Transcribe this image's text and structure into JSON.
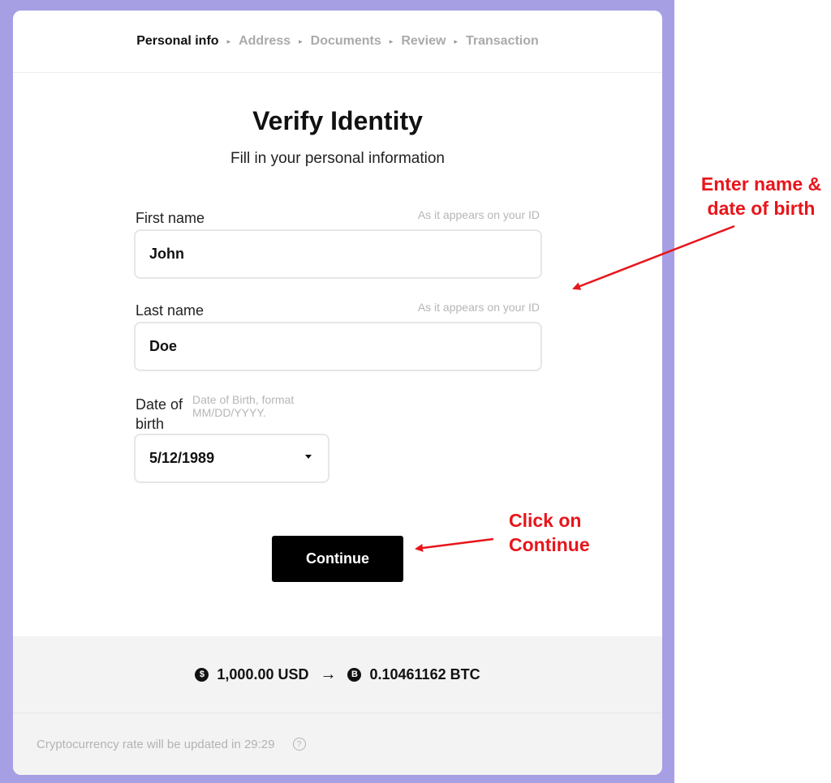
{
  "steps": [
    "Personal info",
    "Address",
    "Documents",
    "Review",
    "Transaction"
  ],
  "active_step": "Personal info",
  "page": {
    "title": "Verify Identity",
    "subtitle": "Fill in your personal information"
  },
  "form": {
    "first_name": {
      "label": "First name",
      "hint": "As it appears on your ID",
      "value": "John"
    },
    "last_name": {
      "label": "Last name",
      "hint": "As it appears on your ID",
      "value": "Doe"
    },
    "dob": {
      "label_line1": "Date of",
      "label_line2": "birth",
      "hint_line1": "Date of Birth, format",
      "hint_line2": "MM/DD/YYYY.",
      "value": "5/12/1989"
    },
    "continue_label": "Continue"
  },
  "summary": {
    "from_amount": "1,000.00 USD",
    "arrow": "→",
    "to_amount": "0.10461162 BTC"
  },
  "footer": {
    "text": "Cryptocurrency rate will be updated in 29:29",
    "help_glyph": "?"
  },
  "annotations": {
    "name_dob_line1": "Enter name &",
    "name_dob_line2": "date of birth",
    "continue_line1": "Click on",
    "continue_line2": "Continue"
  },
  "colors": {
    "frame": "#a79fe3",
    "annotation": "#e8151b",
    "button": "#000000"
  }
}
